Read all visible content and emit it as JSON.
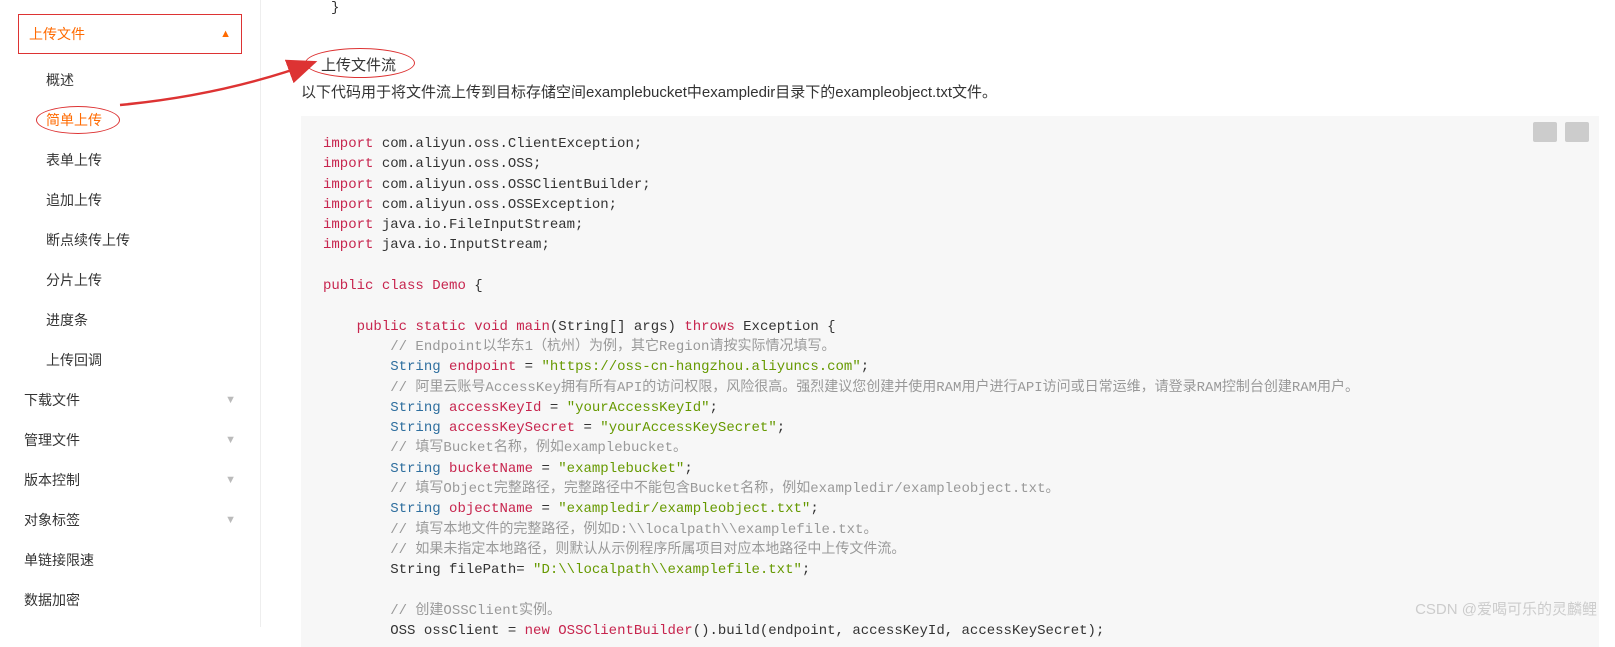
{
  "sidebar": {
    "upload_header": "上传文件",
    "items": {
      "overview": "概述",
      "simple": "简单上传",
      "form": "表单上传",
      "append": "追加上传",
      "resume": "断点续传上传",
      "multipart": "分片上传",
      "progress": "进度条",
      "callback": "上传回调"
    },
    "groups": {
      "download": "下载文件",
      "manage": "管理文件",
      "version": "版本控制",
      "tag": "对象标签",
      "speed": "单链接限速",
      "encrypt": "数据加密"
    }
  },
  "article": {
    "brace": "}",
    "section_title": "上传文件流",
    "desc": "以下代码用于将文件流上传到目标存储空间examplebucket中exampledir目录下的exampleobject.txt文件。"
  },
  "code": {
    "l1a": "import",
    "l1b": " com.aliyun.oss.ClientException;",
    "l2a": "import",
    "l2b": " com.aliyun.oss.OSS;",
    "l3a": "import",
    "l3b": " com.aliyun.oss.OSSClientBuilder;",
    "l4a": "import",
    "l4b": " com.aliyun.oss.OSSException;",
    "l5a": "import",
    "l5b": " java.io.FileInputStream;",
    "l6a": "import",
    "l6b": " java.io.InputStream;",
    "l8a": "public",
    "l8b": "class",
    "l8c": "Demo",
    "l8d": " {",
    "l10a": "public",
    "l10b": "static",
    "l10c": "void",
    "l10d": "main",
    "l10e": "(String[] args)",
    "l10f": "throws",
    "l10g": " Exception {",
    "l11": "// Endpoint以华东1（杭州）为例，其它Region请按实际情况填写。",
    "l12a": "String",
    "l12b": "endpoint",
    "l12c": " = ",
    "l12d": "\"https://oss-cn-hangzhou.aliyuncs.com\"",
    "l12e": ";",
    "l13": "// 阿里云账号AccessKey拥有所有API的访问权限，风险很高。强烈建议您创建并使用RAM用户进行API访问或日常运维，请登录RAM控制台创建RAM用户。",
    "l14a": "String",
    "l14b": "accessKeyId",
    "l14c": " = ",
    "l14d": "\"yourAccessKeyId\"",
    "l14e": ";",
    "l15a": "String",
    "l15b": "accessKeySecret",
    "l15c": " = ",
    "l15d": "\"yourAccessKeySecret\"",
    "l15e": ";",
    "l16": "// 填写Bucket名称，例如examplebucket。",
    "l17a": "String",
    "l17b": "bucketName",
    "l17c": " = ",
    "l17d": "\"examplebucket\"",
    "l17e": ";",
    "l18": "// 填写Object完整路径，完整路径中不能包含Bucket名称，例如exampledir/exampleobject.txt。",
    "l19a": "String",
    "l19b": "objectName",
    "l19c": " = ",
    "l19d": "\"exampledir/exampleobject.txt\"",
    "l19e": ";",
    "l20": "// 填写本地文件的完整路径，例如D:\\\\localpath\\\\examplefile.txt。",
    "l21": "// 如果未指定本地路径，则默认从示例程序所属项目对应本地路径中上传文件流。",
    "l22a": "String filePath= ",
    "l22b": "\"D:\\\\localpath\\\\examplefile.txt\"",
    "l22c": ";",
    "l24": "// 创建OSSClient实例。",
    "l25a": "OSS ossClient = ",
    "l25b": "new",
    "l25c": "OSSClientBuilder",
    "l25d": "().build(endpoint, accessKeyId, accessKeySecret);"
  },
  "watermark": "CSDN @爱喝可乐的灵麟鲤"
}
